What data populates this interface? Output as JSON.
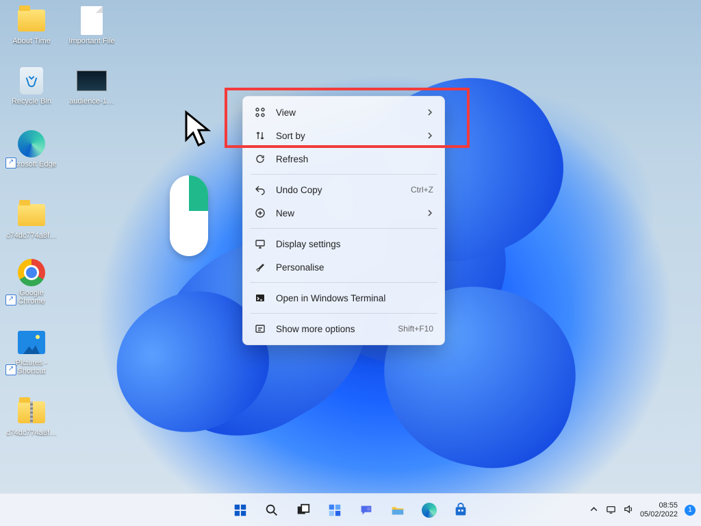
{
  "desktop_icons": {
    "about_time": "About Time",
    "important_file": "Important File",
    "recycle_bin": "Recycle Bin",
    "audience": "audience-1…",
    "edge": "Microsoft Edge",
    "folder1": "c74dc774a8f…",
    "chrome": "Google Chrome",
    "pictures": "Pictures - Shortcut",
    "folder2": "c74dc774a8f…"
  },
  "context_menu": {
    "view": "View",
    "sort_by": "Sort by",
    "refresh": "Refresh",
    "undo_copy": "Undo Copy",
    "undo_copy_hint": "Ctrl+Z",
    "new": "New",
    "display_settings": "Display settings",
    "personalise": "Personalise",
    "terminal": "Open in Windows Terminal",
    "more": "Show more options",
    "more_hint": "Shift+F10"
  },
  "tray": {
    "time": "08:55",
    "date": "05/02/2022",
    "notif_count": "1"
  }
}
